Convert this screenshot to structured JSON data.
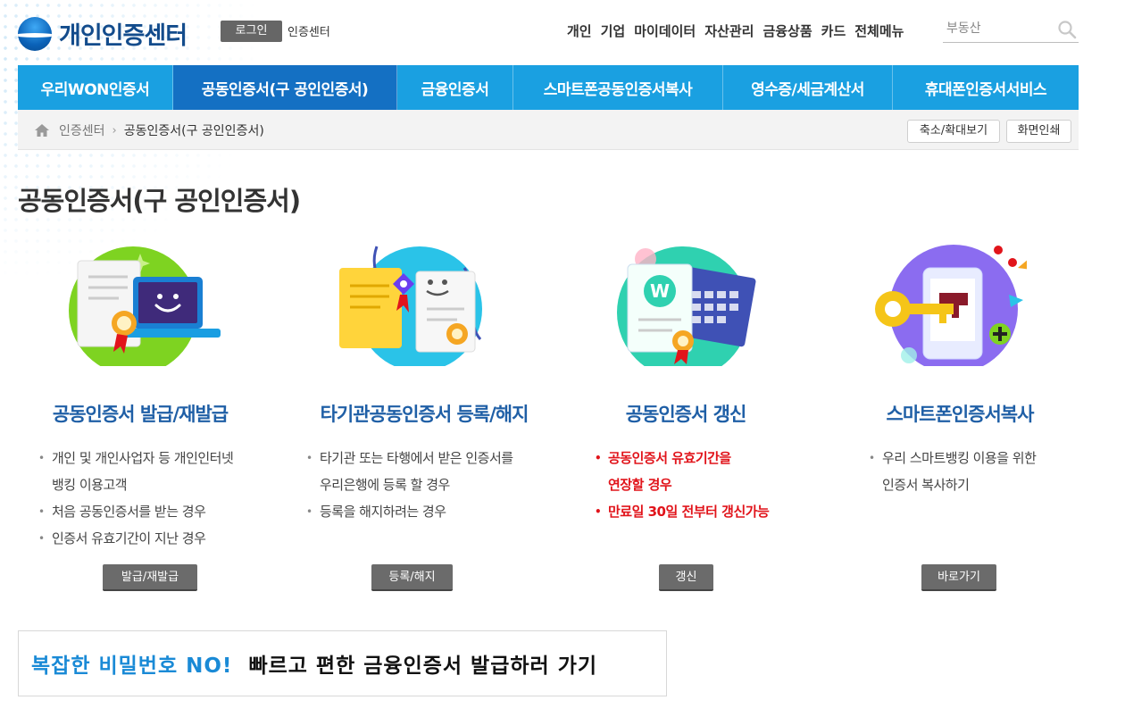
{
  "header": {
    "logo_text": "개인인증센터",
    "login_label": "로그인",
    "center_link": "인증센터",
    "topnav": [
      "개인",
      "기업",
      "마이데이터",
      "자산관리",
      "금융상품",
      "카드",
      "전체메뉴"
    ],
    "search_placeholder": "부동산"
  },
  "tabs": [
    {
      "label": "우리WON인증서",
      "active": false
    },
    {
      "label": "공동인증서(구 공인인증서)",
      "active": true
    },
    {
      "label": "금융인증서",
      "active": false
    },
    {
      "label": "스마트폰공동인증서복사",
      "active": false
    },
    {
      "label": "영수증/세금계산서",
      "active": false
    },
    {
      "label": "휴대폰인증서서비스",
      "active": false
    }
  ],
  "breadcrumb": {
    "home": "인증센터",
    "current": "공동인증서(구 공인인증서)",
    "zoom_label": "축소/확대보기",
    "print_label": "화면인쇄"
  },
  "page_title": "공동인증서(구 공인인증서)",
  "cards": [
    {
      "title": "공동인증서 발급/재발급",
      "lines": [
        "개인 및 개인사업자 등 개인인터넷",
        "뱅킹 이용고객",
        "처음 공동인증서를 받는 경우",
        "인증서 유효기간이 지난 경우"
      ],
      "button": "발급/재발급"
    },
    {
      "title": "타기관공동인증서 등록/해지",
      "lines": [
        "타기관 또는 타행에서 받은 인증서를",
        "우리은행에 등록 할 경우",
        "등록을 해지하려는 경우"
      ],
      "button": "등록/해지"
    },
    {
      "title": "공동인증서 갱신",
      "lines": [
        "공동인증서 유효기간을",
        "연장할 경우",
        "만료일 30일 전부터 갱신가능"
      ],
      "button": "갱신"
    },
    {
      "title": "스마트폰인증서복사",
      "lines": [
        "우리 스마트뱅킹 이용을 위한",
        "인증서 복사하기"
      ],
      "button": "바로가기"
    }
  ],
  "promo": {
    "highlight": "복잡한 비밀번호 NO!",
    "text": "빠르고 편한 금융인증서 발급하러 가기"
  },
  "colors": {
    "tab_bg": "#1aa0e1",
    "tab_active": "#1470c3",
    "card_title": "#1f5fa6",
    "alert_red": "#e1141b"
  }
}
